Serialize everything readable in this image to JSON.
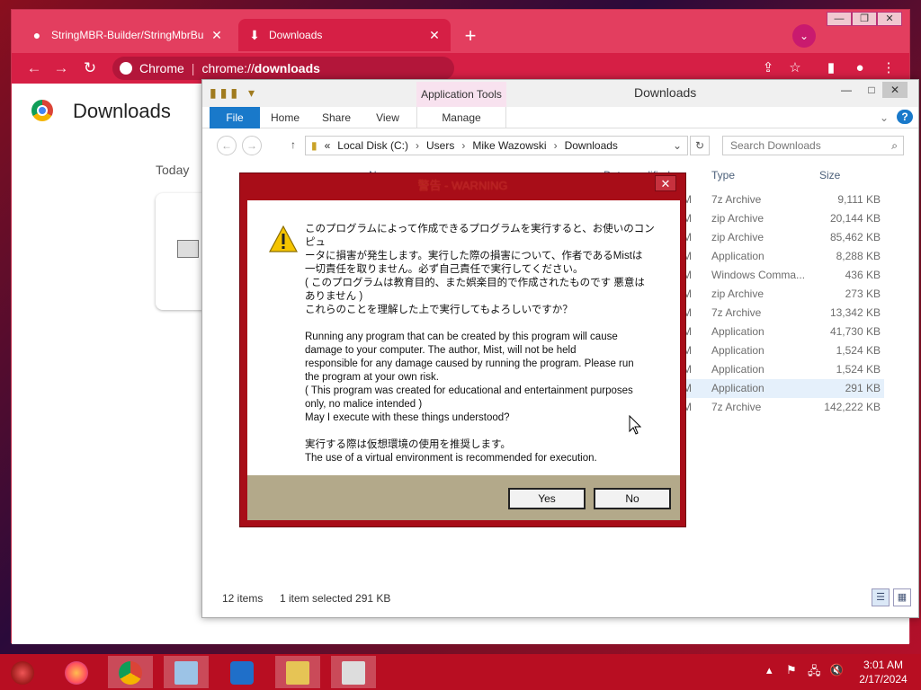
{
  "browser": {
    "tabs": [
      {
        "title": "StringMBR-Builder/StringMbrBu",
        "icon": "github-icon"
      },
      {
        "title": "Downloads",
        "icon": "download-icon"
      }
    ],
    "window_controls": {
      "minimize": "—",
      "restore": "❐",
      "close": "✕"
    },
    "omnibox": {
      "site": "Chrome",
      "url_prefix": "chrome://",
      "url_host": "downloads"
    }
  },
  "downloads_page": {
    "title": "Downloads",
    "group": "Today"
  },
  "explorer": {
    "app_tools": "Application Tools",
    "title": "Downloads",
    "ribbon_tabs": {
      "file": "File",
      "home": "Home",
      "share": "Share",
      "view": "View",
      "manage": "Manage"
    },
    "breadcrumb": [
      "«",
      "Local Disk (C:)",
      "Users",
      "Mike Wazowski",
      "Downloads"
    ],
    "search_placeholder": "Search Downloads",
    "columns": {
      "name": "Name",
      "date": "Date modified",
      "type": "Type",
      "size": "Size"
    },
    "rows": [
      {
        "type": "7z Archive",
        "size": "9,111 KB"
      },
      {
        "type": "zip Archive",
        "size": "20,144 KB"
      },
      {
        "type": "zip Archive",
        "size": "85,462 KB"
      },
      {
        "type": "Application",
        "size": "8,288 KB"
      },
      {
        "type": "Windows Comma...",
        "size": "436 KB"
      },
      {
        "type": "zip Archive",
        "size": "273 KB"
      },
      {
        "type": "7z Archive",
        "size": "13,342 KB"
      },
      {
        "type": "Application",
        "size": "41,730 KB"
      },
      {
        "type": "Application",
        "size": "1,524 KB"
      },
      {
        "type": "Application",
        "size": "1,524 KB"
      },
      {
        "type": "Application",
        "size": "291 KB",
        "selected": true
      },
      {
        "type": "7z Archive",
        "size": "142,222 KB"
      }
    ],
    "status": {
      "items": "12 items",
      "selection": "1 item selected  291 KB"
    }
  },
  "dialog": {
    "title": "警告 - WARNING",
    "close": "✕",
    "message": "このプログラムによって作成できるプログラムを実行すると、お使いのコンピュ\nータに損害が発生します。実行した際の損害について、作者であるMistは\n一切責任を取りません。必ず自己責任で実行してください。\n( このプログラムは教育目的、また娯楽目的で作成されたものです 悪意は\nありません )\nこれらのことを理解した上で実行してもよろしいですか？\n\nRunning any program that can be created by this program will cause\ndamage to your computer. The author, Mist, will not be held\nresponsible for any damage caused by running the program. Please run\nthe program at your own risk.\n( This program was created for educational and entertainment purposes\nonly, no malice intended )\nMay I execute with these things understood?\n\n実行する際は仮想環境の使用を推奨します。\nThe use of a virtual environment is recommended for execution.",
    "yes": "Yes",
    "no": "No"
  },
  "taskbar": {
    "clock_time": "3:01 AM",
    "clock_date": "2/17/2024"
  },
  "colors": {
    "chrome_tabbar": "#e33e5f",
    "dialog_frame": "#a80d18",
    "taskbar": "#b80e22",
    "file_tab": "#1979ca"
  }
}
